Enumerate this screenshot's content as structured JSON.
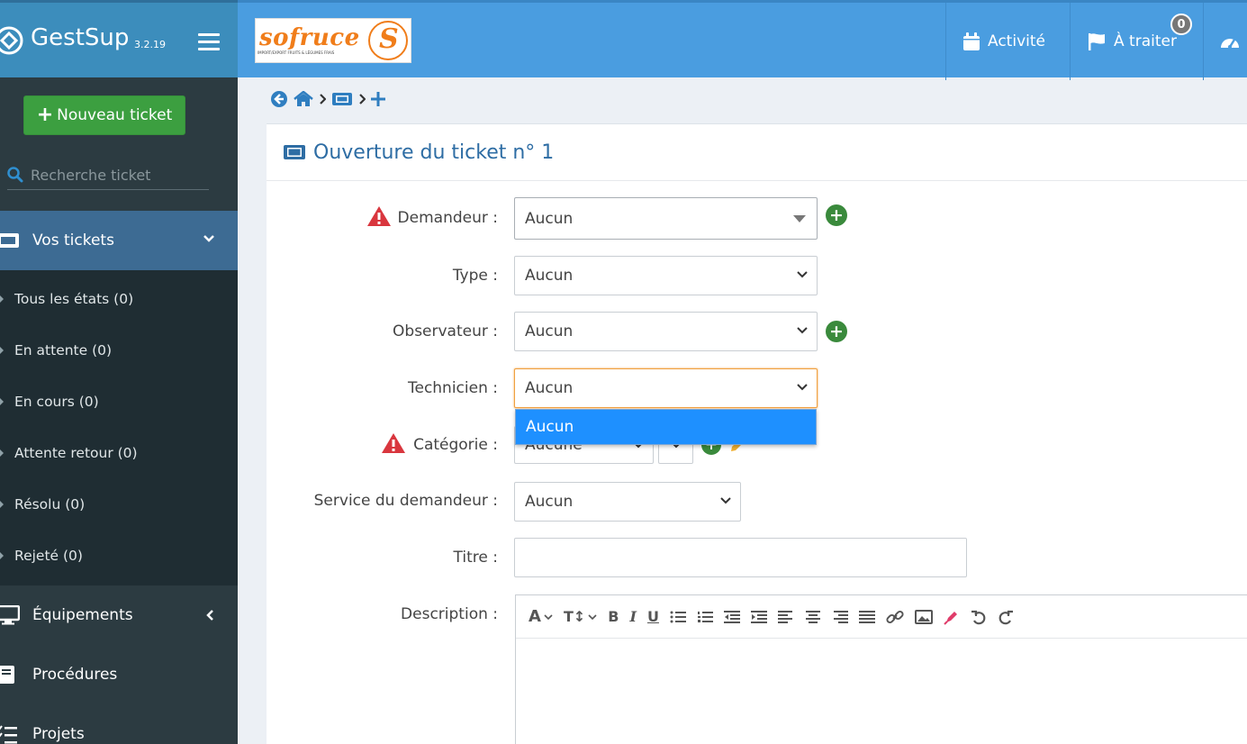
{
  "app": {
    "name": "GestSup",
    "version": "3.2.19"
  },
  "company_logo": {
    "word": "sofruce",
    "tagline": "IMPORT/EXPORT FRUITS & LÉGUMES FRAIS",
    "circle_letter": "S"
  },
  "topnav": {
    "activite": "Activité",
    "a_traiter": "À traiter",
    "a_traiter_count": "0"
  },
  "sidebar": {
    "new_ticket": "Nouveau ticket",
    "search_placeholder": "Recherche ticket",
    "vos_tickets": "Vos tickets",
    "states": [
      "Tous les états (0)",
      "En attente (0)",
      "En cours (0)",
      "Attente retour (0)",
      "Résolu (0)",
      "Rejeté (0)"
    ],
    "equipements": "Équipements",
    "procedures": "Procédures",
    "projets": "Projets"
  },
  "panel": {
    "title": "Ouverture du ticket n° 1"
  },
  "form": {
    "demandeur_label": "Demandeur :",
    "demandeur_value": "Aucun",
    "type_label": "Type :",
    "type_value": "Aucun",
    "observateur_label": "Observateur :",
    "observateur_value": "Aucun",
    "technicien_label": "Technicien :",
    "technicien_value": "Aucun",
    "technicien_dropdown_option": "Aucun",
    "categorie_label": "Catégorie :",
    "categorie_value": "Aucune",
    "service_label": "Service du demandeur :",
    "service_value": "Aucun",
    "titre_label": "Titre :",
    "titre_value": "",
    "description_label": "Description :"
  },
  "colors": {
    "brand": "#3c8dbc",
    "topbar": "#4a9de0",
    "sidebar": "#2c3b41",
    "sidebar_active": "#3d6b93",
    "new_ticket": "#3c9f40",
    "dropdown_highlight": "#1e90ff",
    "warning": "#d9363e"
  }
}
